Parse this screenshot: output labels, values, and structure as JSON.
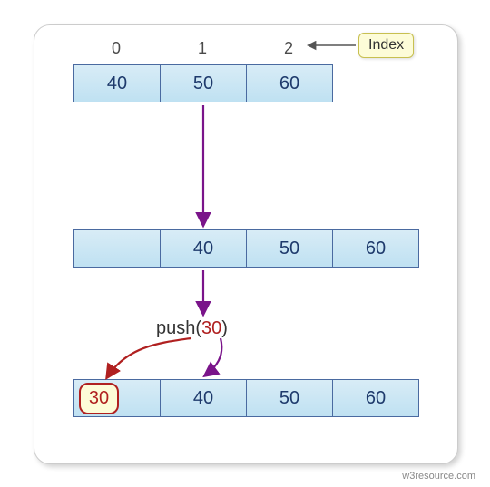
{
  "chart_data": {
    "type": "table",
    "title": "",
    "index_label": "Index",
    "index_values": [
      "0",
      "1",
      "2"
    ],
    "arrays": {
      "before": [
        "40",
        "50",
        "60"
      ],
      "shifted": [
        "",
        "40",
        "50",
        "60"
      ],
      "after": [
        "30",
        "40",
        "50",
        "60"
      ]
    },
    "operation": {
      "name": "push",
      "arg": "30"
    }
  },
  "attrib": "w3resource.com"
}
